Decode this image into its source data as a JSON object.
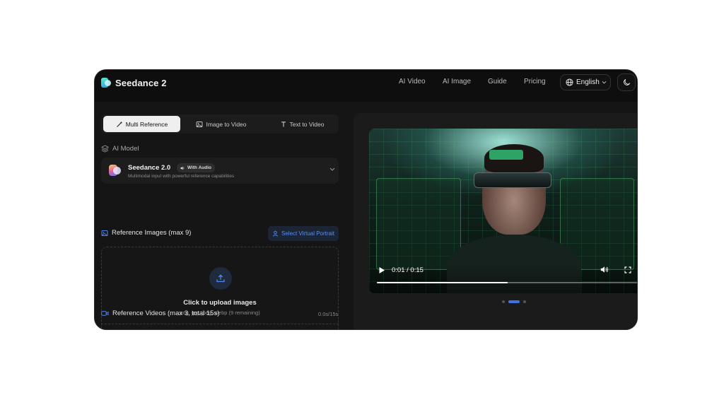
{
  "header": {
    "brand": "Seedance 2",
    "nav": [
      "AI Video",
      "AI Image",
      "Guide",
      "Pricing"
    ],
    "language": "English"
  },
  "tabs": [
    {
      "label": "Multi Reference",
      "active": true
    },
    {
      "label": "Image to Video",
      "active": false
    },
    {
      "label": "Text to Video",
      "active": false
    }
  ],
  "model_section": {
    "label": "AI Model",
    "name": "Seedance 2.0",
    "badge": "With Audio",
    "description": "Multimodal input with powerful reference capabilities"
  },
  "reference_images": {
    "label": "Reference Images (max 9)",
    "portrait_button": "Select Virtual Portrait",
    "upload_title": "Click to upload images",
    "upload_sub": "png, jpg, jpeg, webp (9 remaining)"
  },
  "reference_videos": {
    "label": "Reference Videos (max 3, total 15s)",
    "duration": "0.0s/15s"
  },
  "player": {
    "time": "0:01 / 0:15",
    "progress": 0.5,
    "slides_total": 3,
    "slide_active": 2
  },
  "colors": {
    "accent": "#3b74e8",
    "background": "#151515",
    "active_tab": "#efefef"
  }
}
